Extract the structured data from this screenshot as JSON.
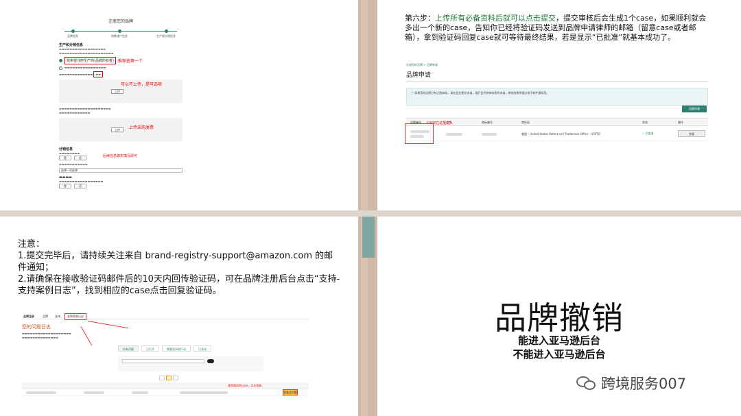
{
  "q1": {
    "form_title": "注册您的品牌",
    "steps": [
      "品牌信息",
      "销售账户信息",
      "生产和分销信息"
    ],
    "section_title": "生产和分销信息",
    "radio_selected": "我希望注册生产商(品牌所有者)",
    "ann_recommend": "推荐选第一个",
    "ann_optional": "可以不上传，是可选项",
    "upload_label": "上传",
    "ann_invoice": "上传采购发票",
    "section2_title": "分销信息",
    "ann_fill": "后续信息如实填写即可",
    "select_placeholder": "选择一项选择",
    "btn_yes": "是",
    "btn_no": "否"
  },
  "q2": {
    "instruction_prefix": "第六步：",
    "instruction_green": "上传所有必备资料后就可以点击提交",
    "instruction_rest": "，提交审核后会生成1个case，如果顺利就会多出一个新的case，告知你已经将验证码发送到品牌申请律师的邮箱（留意case或者邮箱），拿到验证码回复case就可等待最终结果，若是显示“已批准”就基本成功了。",
    "breadcrumb": "注册您的品牌 > 品牌申请",
    "page_title": "品牌申请",
    "info_text": "如果您的品牌已有注册商标，请在此处提交申请，我们会尽快审核您的申请，审核结果将通过电子邮件通知您。",
    "create_button": "创建申请",
    "columns": [
      "问题编号",
      "品牌",
      "商标编号",
      "商标局",
      "状态",
      "操作"
    ],
    "row_office": "美国 - United States Patent and Trademark Office - USPTO",
    "row_status": "✓ 已批准",
    "row_action": "答复",
    "case_annotation": "CASE在这里进入"
  },
  "q3": {
    "note_title": "注意：",
    "note_1": "1.提交完毕后，请持续关注来自 brand-registry-support@amazon.com 的邮件通知；",
    "note_2": "2.请确保在接收验证码邮件后的10天内回传验证码，可在品牌注册后台点击“支持-支持案例日志”，找到相应的case点击回复验证码。",
    "nav_items": [
      "品牌注册",
      "品牌",
      "支持"
    ],
    "log_title": "您的问题日志",
    "tabs": [
      "所有问题",
      "已打开",
      "需要您采取行动",
      "已关闭"
    ],
    "reply_label": "答复此问题",
    "ann_support": "支持案例日志",
    "ann_reply": "找到相应的case，点击答复"
  },
  "q4": {
    "title": "品牌撤销",
    "line1": "能进入亚马逊后台",
    "line2": "不能进入亚马逊后台",
    "watermark": "跨境服务007"
  }
}
